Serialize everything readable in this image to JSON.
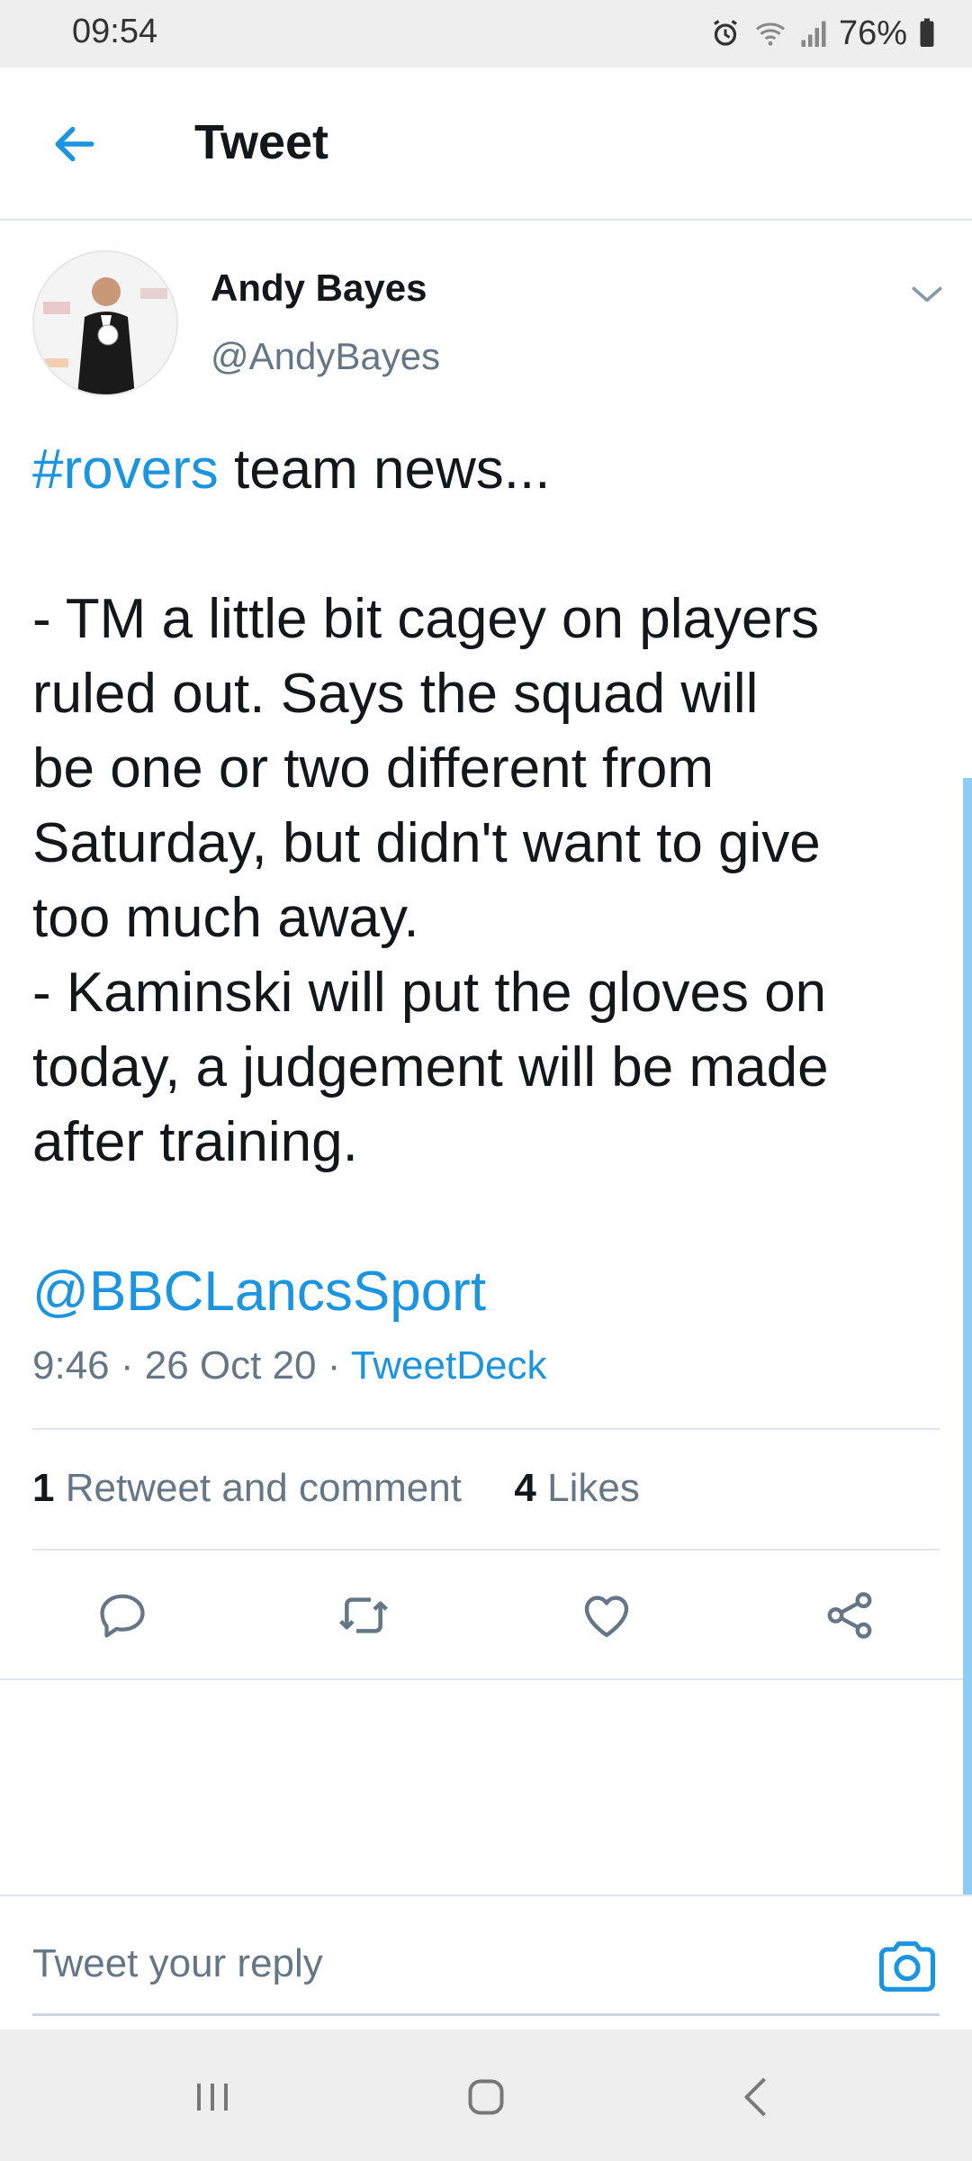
{
  "status_bar": {
    "time": "09:54",
    "battery": "76%"
  },
  "header": {
    "title": "Tweet"
  },
  "tweet": {
    "author_name": "Andy Bayes",
    "author_handle": "@AndyBayes",
    "hashtag": "#rovers",
    "first_line_rest": " team news...",
    "body_lines": [
      "- TM a little bit cagey on players",
      "ruled out.  Says the squad will",
      "be one or two different from",
      "Saturday, but didn't want to give",
      "too much away.",
      "- Kaminski will put the gloves on",
      "today, a judgement will be made",
      "after training."
    ],
    "mention": "@BBCLancsSport",
    "timestamp": "9:46 · 26 Oct 20 · ",
    "source": "TweetDeck"
  },
  "stats": {
    "retweets_count": "1",
    "retweets_label": "Retweet and comment",
    "likes_count": "4",
    "likes_label": "Likes"
  },
  "reply": {
    "placeholder": "Tweet your reply"
  },
  "colors": {
    "accent": "#1b95e0",
    "muted": "#657786",
    "text": "#14171a"
  },
  "icons": [
    "back-arrow-icon",
    "chevron-down-icon",
    "reply-icon",
    "retweet-icon",
    "like-icon",
    "share-icon",
    "camera-icon",
    "alarm-icon",
    "wifi-icon",
    "signal-icon",
    "battery-icon"
  ]
}
